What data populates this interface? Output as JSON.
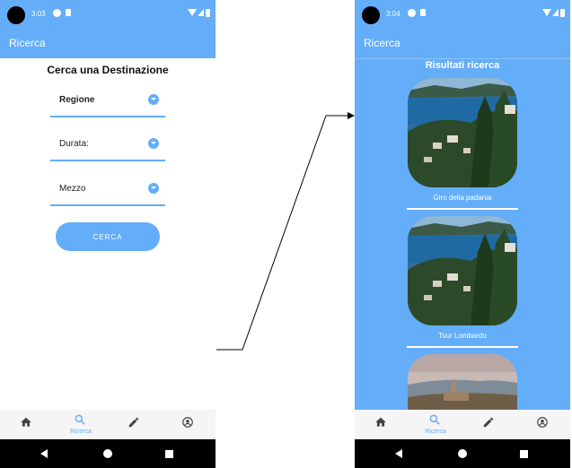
{
  "left_screen": {
    "status_time": "3:03",
    "app_title": "Ricerca",
    "form_title": "Cerca una Destinazione",
    "fields": [
      {
        "label": "Regione"
      },
      {
        "label": "Durata:"
      },
      {
        "label": "Mezzo"
      }
    ],
    "search_button": "CERCA",
    "nav": {
      "active_label": "Ricerca"
    }
  },
  "right_screen": {
    "status_time": "3:04",
    "app_title": "Ricerca",
    "results_title": "Risultati ricerca",
    "results": [
      {
        "title": "Giro della padania"
      },
      {
        "title": "Tour Lombardo"
      },
      {
        "title": ""
      }
    ],
    "nav": {
      "active_label": "Ricerca"
    }
  },
  "colors": {
    "accent": "#64adf9",
    "white": "#ffffff",
    "black": "#000000"
  },
  "icons": [
    "home-icon",
    "search-icon",
    "edit-pencil-icon",
    "account-circle-icon",
    "wifi-icon",
    "signal-icon",
    "battery-icon",
    "dropdown-icon"
  ]
}
